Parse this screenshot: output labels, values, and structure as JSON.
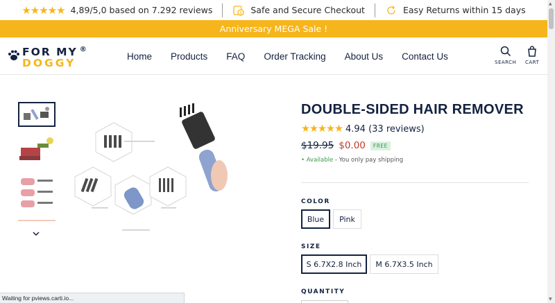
{
  "trustbar": {
    "rating_text": "4,89/5,0 based on 7.292 reviews",
    "secure_text": "Safe and Secure Checkout",
    "returns_text": "Easy Returns within 15 days"
  },
  "announcement": "Anniversary MEGA Sale !",
  "logo": {
    "line1": "FOR MY",
    "line2": "DOGGY",
    "mark": "®"
  },
  "nav": {
    "home": "Home",
    "products": "Products",
    "faq": "FAQ",
    "order_tracking": "Order Tracking",
    "about": "About Us",
    "contact": "Contact Us"
  },
  "header_icons": {
    "search": "SEARCH",
    "cart": "CART"
  },
  "product": {
    "title": "DOUBLE-SIDED HAIR REMOVER",
    "rating_value": "4.94",
    "reviews": "(33 reviews)",
    "old_price": "$19.95",
    "new_price": "$0.00",
    "free_badge": "FREE",
    "availability": "Available",
    "shipping_note": " - You only pay shipping",
    "color_label": "COLOR",
    "colors": [
      "Blue",
      "Pink"
    ],
    "selected_color": "Blue",
    "size_label": "SIZE",
    "sizes": [
      "S 6.7X2.8 Inch",
      "M 6.7X3.5 Inch"
    ],
    "selected_size": "S 6.7X2.8 Inch",
    "quantity_label": "QUANTITY"
  },
  "status_bar": "Waiting for pviews.carti.io...",
  "colors": {
    "accent": "#f6b51b",
    "navy": "#12213f",
    "sale_red": "#c0392b"
  }
}
